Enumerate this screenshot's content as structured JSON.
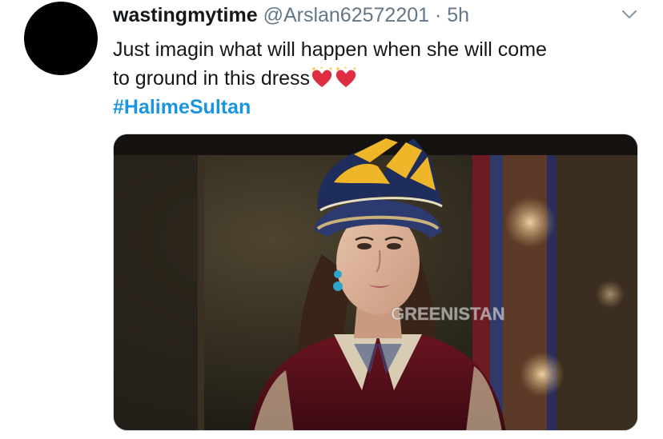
{
  "tweet": {
    "author_name": "wastingmytime",
    "author_handle": "@Arslan62572201",
    "separator": "·",
    "time": "5h",
    "text_line1": "Just imagin what will happen when she will come",
    "text_line2": "to ground in this dress",
    "emojis": [
      "sparkling-heart-icon",
      "sparkling-heart-icon"
    ],
    "hashtag": "#HalimeSultan"
  },
  "media": {
    "watermark": "GREENISTAN"
  },
  "colors": {
    "name": "#14171a",
    "secondary": "#657786",
    "link": "#1b95e0"
  }
}
